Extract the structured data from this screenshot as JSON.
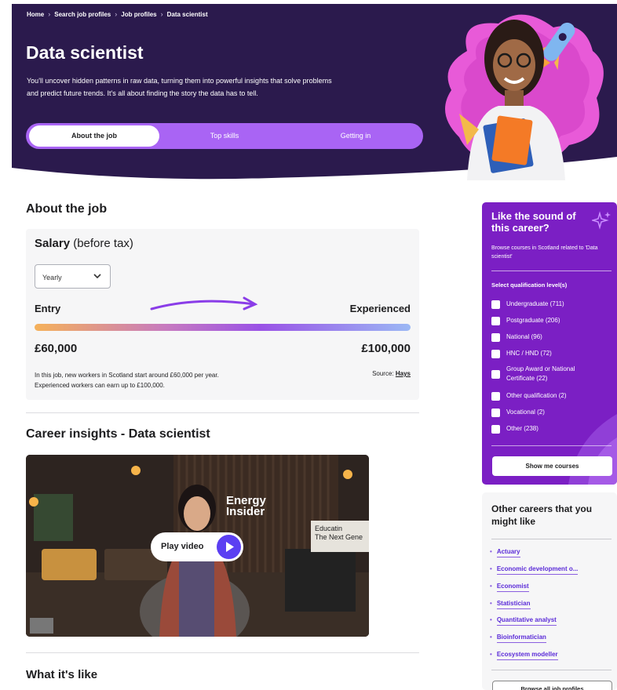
{
  "breadcrumb": [
    "Home",
    "Search job profiles",
    "Job profiles",
    "Data scientist"
  ],
  "hero": {
    "title": "Data scientist",
    "description": "You'll uncover hidden patterns in raw data, turning them into powerful insights that solve problems and predict future trends. It's all about finding the story the data has to tell.",
    "tabs": [
      "About the job",
      "Top skills",
      "Getting in"
    ]
  },
  "about": {
    "title": "About the job",
    "salary_title_bold": "Salary",
    "salary_title_rest": " (before tax)",
    "period": "Yearly",
    "entry_label": "Entry",
    "experienced_label": "Experienced",
    "entry_value": "£60,000",
    "experienced_value": "£100,000",
    "note": "In this job, new workers in Scotland start around £60,000 per year. Experienced workers can earn up to £100,000.",
    "source_label": "Source:",
    "source_link": "Hays"
  },
  "insights": {
    "prefix": "Career insights - ",
    "bold": "Data scientist",
    "play_label": "Play video",
    "logo_line1": "Energy",
    "logo_line2": "Insider",
    "sign_line1": "Educatin",
    "sign_line2": "The Next Gene"
  },
  "what_title": "What it's like",
  "sidebar": {
    "like_title": "Like the sound of this career?",
    "like_sub": "Browse courses in Scotland related to 'Data scientist'",
    "select_label": "Select qualification level(s)",
    "qualifications": [
      "Undergraduate (711)",
      "Postgraduate (206)",
      "National (96)",
      "HNC / HND (72)",
      "Group Award or National Certificate (22)",
      "Other qualification (2)",
      "Vocational (2)",
      "Other (238)"
    ],
    "show_button": "Show me courses",
    "other_title": "Other careers that you might like",
    "careers": [
      "Actuary",
      "Economic development o...",
      "Economist",
      "Statistician",
      "Quantitative analyst",
      "Bioinformatician",
      "Ecosystem modeller"
    ],
    "browse_button": "Browse all job profiles"
  },
  "colors": {
    "hero_bg": "#2b1a4d",
    "tab_bar": "#a964f4",
    "sidebar_purple": "#7b1fc4",
    "link": "#5b2bd8"
  }
}
